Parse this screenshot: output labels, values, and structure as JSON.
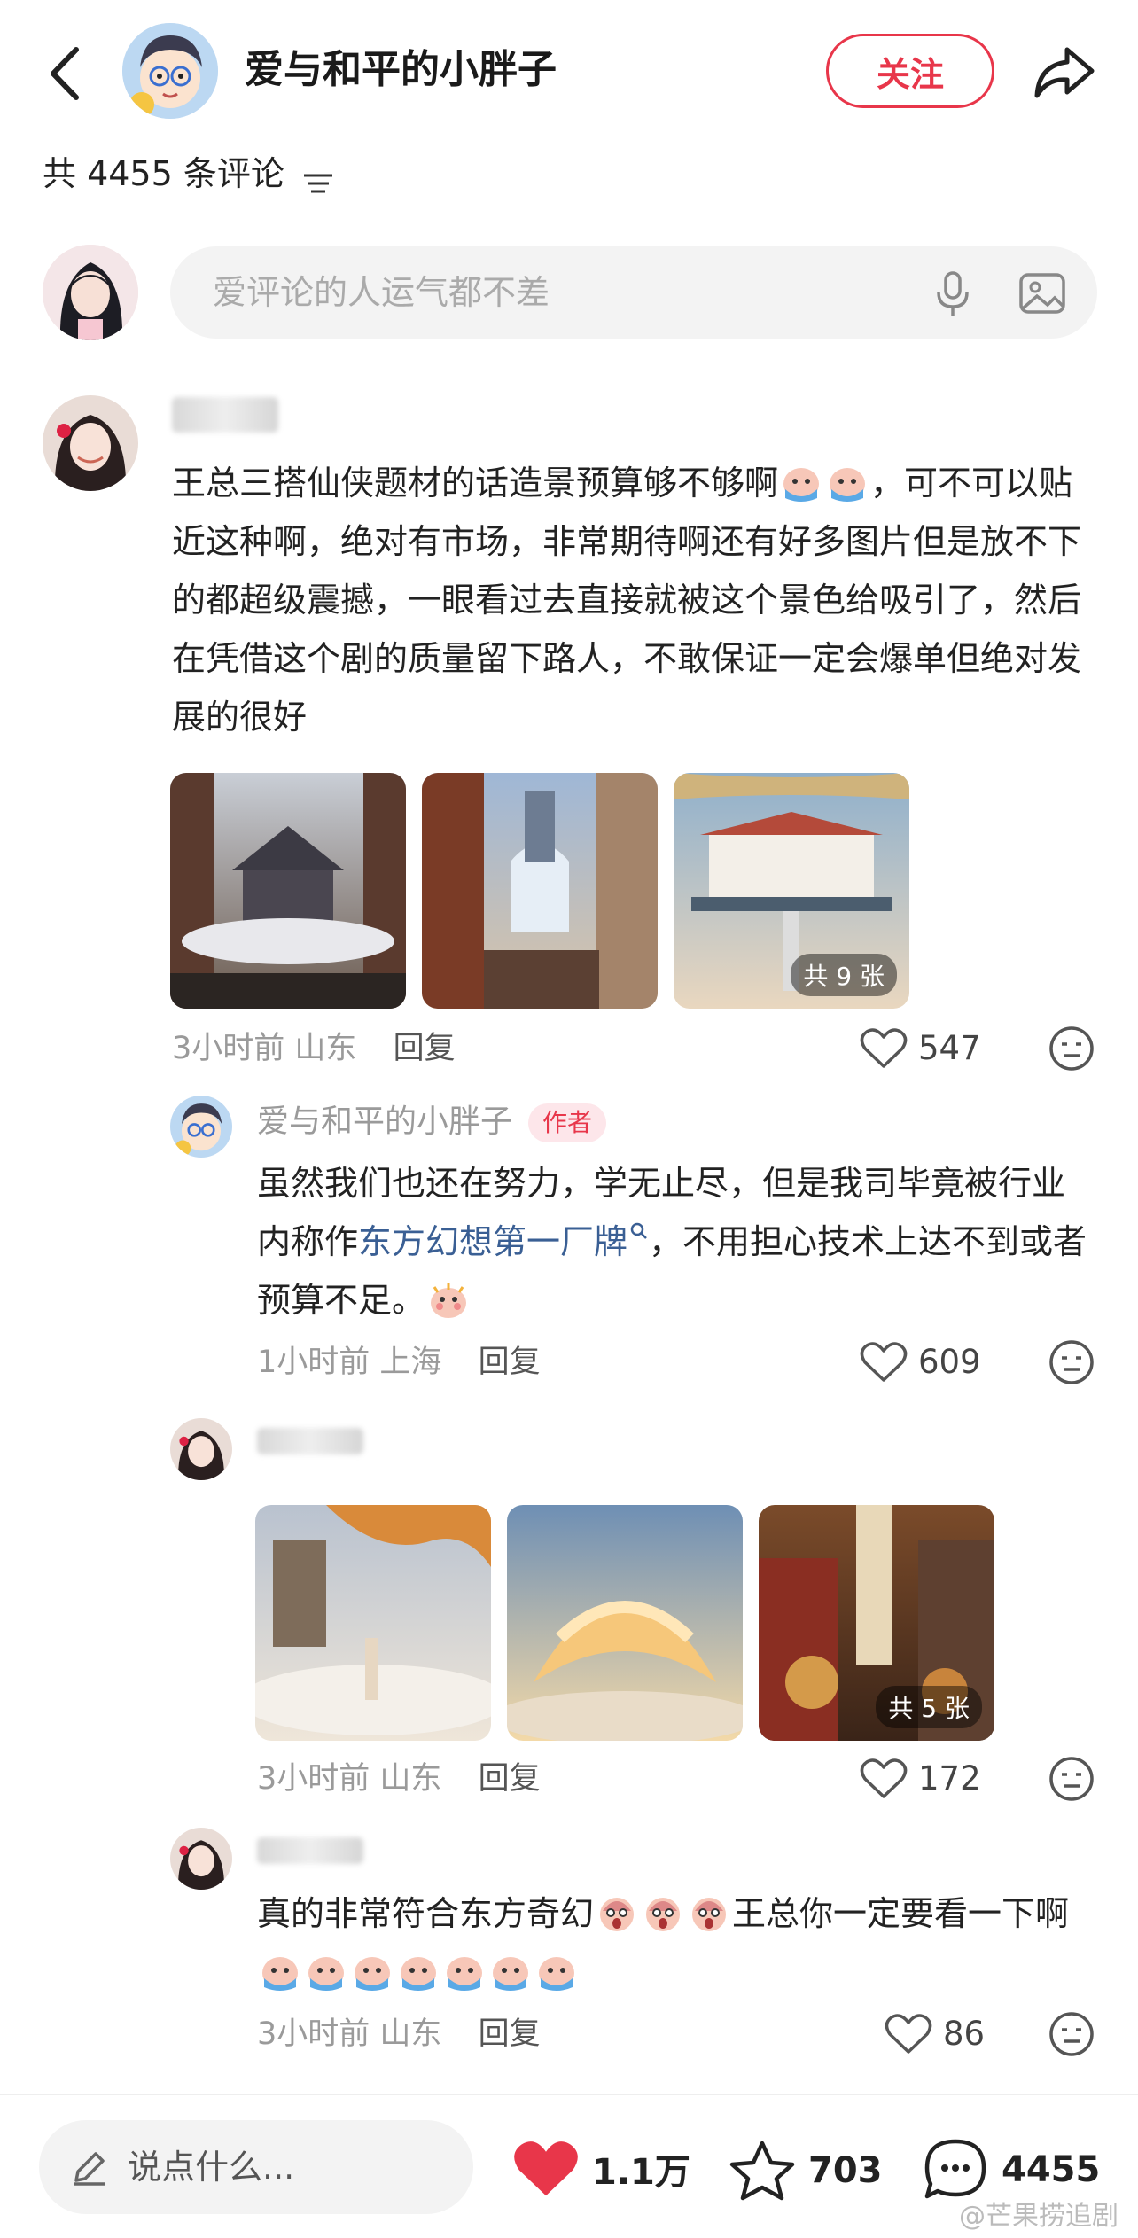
{
  "header": {
    "author_name": "爱与和平的小胖子",
    "follow_label": "关注"
  },
  "comments_count_label": "共 4455 条评论",
  "comment_input": {
    "placeholder": "爱评论的人运气都不差"
  },
  "comments": [
    {
      "text": "王总三搭仙侠题材的话造景预算够不够啊",
      "text_after_emoji": "，可不可以贴近这种啊，绝对有市场，非常期待啊还有好多图片但是放不下的都超级震撼，一眼看过去直接就被这个景色给吸引了，然后在凭借这个剧的质量留下路人，不敢保证一定会爆单但绝对发展的很好",
      "images_badge": "共 9 张",
      "time": "3小时前",
      "location": "山东",
      "reply_label": "回复",
      "likes": "547",
      "replies": [
        {
          "username": "爱与和平的小胖子",
          "author_tag": "作者",
          "text_before": "虽然我们也还在努力，学无止尽，但是我司毕竟被行业内称作",
          "link_text": "东方幻想第一厂牌",
          "text_after": "，不用担心技术上达不到或者预算不足。",
          "time": "1小时前",
          "location": "上海",
          "reply_label": "回复",
          "likes": "609"
        },
        {
          "images_badge": "共 5 张",
          "time": "3小时前",
          "location": "山东",
          "reply_label": "回复",
          "likes": "172"
        },
        {
          "text_before": "真的非常符合东方奇幻",
          "text_mid": "王总你一定要看一下啊",
          "time": "3小时前",
          "location": "山东",
          "reply_label": "回复",
          "likes": "86"
        }
      ]
    }
  ],
  "bottom_bar": {
    "say_placeholder": "说点什么...",
    "likes": "1.1万",
    "favorites": "703",
    "comments": "4455"
  },
  "watermark": "@芒果捞追剧",
  "colors": {
    "accent": "#e8364a",
    "link": "#3a5f94",
    "muted": "#9a9a9a"
  }
}
